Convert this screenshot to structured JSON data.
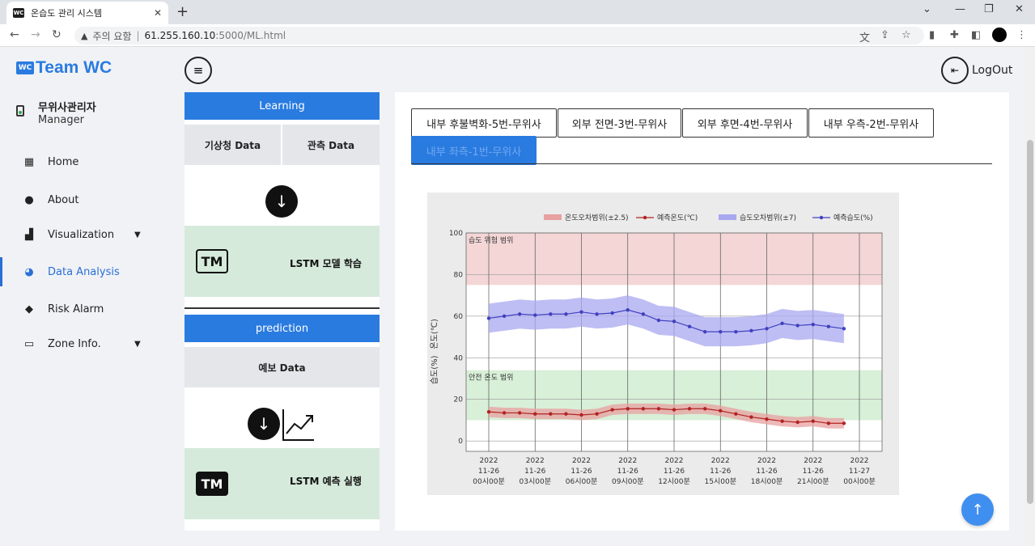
{
  "browser": {
    "tab_title": "온습도 관리 시스템",
    "tab_favicon": "WC",
    "url_warning": "주의 요함",
    "url_host": "61.255.160.10",
    "url_path": ":5000/ML.html"
  },
  "sidebar": {
    "brand_logo": "WC",
    "brand_name": "Team WC",
    "user_name": "무위사관리자",
    "user_role": "Manager",
    "items": [
      {
        "label": "Home",
        "icon": "grid-icon"
      },
      {
        "label": "About",
        "icon": "chat-icon"
      },
      {
        "label": "Visualization",
        "icon": "bar-chart-icon"
      },
      {
        "label": "Data Analysis",
        "icon": "gauge-icon"
      },
      {
        "label": "Risk Alarm",
        "icon": "alert-diamond-icon"
      },
      {
        "label": "Zone Info.",
        "icon": "laptop-icon"
      }
    ]
  },
  "topbar": {
    "logout_label": "LogOut"
  },
  "pipeline": {
    "learning_label": "Learning",
    "weather_data": "기상청 Data",
    "observed_data": "관측 Data",
    "train_label": "LSTM 모델 학습",
    "tm_icon": "TM",
    "prediction_label": "prediction",
    "forecast_data": "예보 Data",
    "run_label": "LSTM 예측 실행"
  },
  "zone_tabs": [
    "내부 후불벽화-5번-무위사",
    "외부 전면-3번-무위사",
    "외부 후면-4번-무위사",
    "내부 우측-2번-무위사",
    "내부 좌측-1번-무위사"
  ],
  "colors": {
    "accent": "#2a7be0",
    "temp_line": "#b22222",
    "humid_line": "#4040c0",
    "temp_band": "#e8a0a0",
    "humid_band": "#a8a8f0"
  },
  "chart_data": {
    "type": "line",
    "legend": [
      "온도오차범위(±2.5)",
      "예측온도(℃)",
      "습도오차범위(±7)",
      "예측습도(%)"
    ],
    "ylabel_temp": "온도(℃)",
    "ylabel_humid": "습도(%)",
    "ylim": [
      -5,
      100
    ],
    "yticks": [
      0,
      20,
      40,
      60,
      80,
      100
    ],
    "xticks": [
      [
        "2022",
        "11-26",
        "00시00분"
      ],
      [
        "2022",
        "11-26",
        "03시00분"
      ],
      [
        "2022",
        "11-26",
        "06시00분"
      ],
      [
        "2022",
        "11-26",
        "09시00분"
      ],
      [
        "2022",
        "11-26",
        "12시00분"
      ],
      [
        "2022",
        "11-26",
        "15시00분"
      ],
      [
        "2022",
        "11-26",
        "18시00분"
      ],
      [
        "2022",
        "11-26",
        "21시00분"
      ],
      [
        "2022",
        "11-27",
        "00시00분"
      ]
    ],
    "danger_zone_label": "습도 위험 범위",
    "danger_zone": [
      75,
      100
    ],
    "safe_zone_label": "안전 온도 범위",
    "safe_zone": [
      10,
      34
    ],
    "x_hours": [
      0,
      1,
      2,
      3,
      4,
      5,
      6,
      7,
      8,
      9,
      10,
      11,
      12,
      13,
      14,
      15,
      16,
      17,
      18,
      19,
      20,
      21,
      22,
      23
    ],
    "humidity": [
      59,
      60,
      61,
      60.5,
      61,
      61,
      62,
      61,
      61.5,
      63,
      61,
      58,
      57.5,
      55,
      52.5,
      52.5,
      52.5,
      53,
      54,
      56.5,
      55.5,
      56,
      55,
      54
    ],
    "temperature": [
      14,
      13.5,
      13.5,
      13,
      13,
      13,
      12.5,
      13,
      15,
      15.5,
      15.5,
      15.5,
      15,
      15.5,
      15.5,
      14.5,
      13,
      11.5,
      10.5,
      9.5,
      9,
      9.5,
      8.5,
      8.5
    ],
    "humid_error": 7,
    "temp_error": 2.5
  }
}
